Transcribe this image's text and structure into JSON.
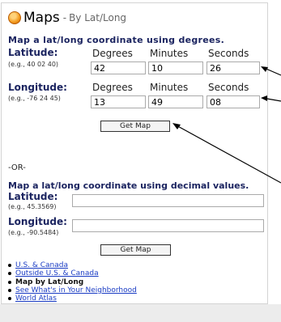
{
  "header": {
    "title": "Maps",
    "separator": "-",
    "subtitle": "By Lat/Long"
  },
  "degrees_section": {
    "intro": "Map a lat/long coordinate using degrees.",
    "columns": [
      "Degrees",
      "Minutes",
      "Seconds"
    ],
    "latitude": {
      "label": "Latitude:",
      "hint": "(e.g., 40 02 40)",
      "degrees": "42",
      "minutes": "10",
      "seconds": "26"
    },
    "longitude": {
      "label": "Longitude:",
      "hint": "(e.g., -76 24 45)",
      "degrees": "13",
      "minutes": "49",
      "seconds": "08"
    },
    "button": "Get Map"
  },
  "or_text": "-OR-",
  "decimal_section": {
    "intro": "Map a lat/long coordinate using decimal values.",
    "latitude": {
      "label": "Latitude:",
      "hint": "(e.g., 45.3569)",
      "value": ""
    },
    "longitude": {
      "label": "Longitude:",
      "hint": "(e.g., -90.5484)",
      "value": ""
    },
    "button": "Get Map"
  },
  "links": [
    {
      "label": "U.S. & Canada",
      "is_link": true
    },
    {
      "label": "Outside U.S. & Canada",
      "is_link": true
    },
    {
      "label": "Map by Lat/Long",
      "is_link": false
    },
    {
      "label": "See What's in Your Neighborhood",
      "is_link": true
    },
    {
      "label": "World Atlas",
      "is_link": true
    }
  ],
  "icons": {
    "logo": "maps-logo-icon"
  },
  "colors": {
    "heading": "#1b2460",
    "link": "#1a3cc4",
    "panel_border": "#d3d3d3"
  }
}
